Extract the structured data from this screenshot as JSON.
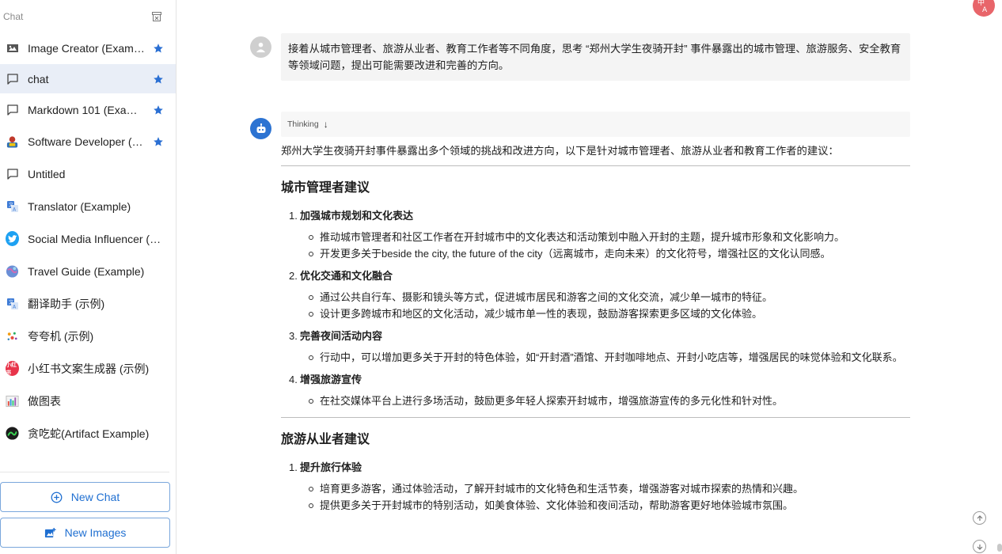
{
  "sidebar": {
    "title": "Chat",
    "items": [
      {
        "label": "Image Creator (Example)",
        "icon": "image-icon",
        "starred": true
      },
      {
        "label": "chat",
        "icon": "chat-bubble-icon",
        "starred": true,
        "active": true
      },
      {
        "label": "Markdown 101 (Example)",
        "icon": "chat-bubble-icon",
        "starred": true
      },
      {
        "label": "Software Developer (Example)",
        "icon": "developer-avatar-icon",
        "starred": true
      },
      {
        "label": "Untitled",
        "icon": "chat-bubble-icon",
        "starred": false
      },
      {
        "label": "Translator (Example)",
        "icon": "translate-icon",
        "starred": false
      },
      {
        "label": "Social Media Influencer (Example)",
        "icon": "twitter-bird-icon",
        "starred": false
      },
      {
        "label": "Travel Guide (Example)",
        "icon": "globe-icon",
        "starred": false
      },
      {
        "label": "翻译助手 (示例)",
        "icon": "translate-icon",
        "starred": false
      },
      {
        "label": "夸夸机 (示例)",
        "icon": "confetti-icon",
        "starred": false
      },
      {
        "label": "小红书文案生成器 (示例)",
        "icon": "xiaohongshu-logo-icon",
        "starred": false
      },
      {
        "label": "做图表",
        "icon": "chart-icon",
        "starred": false
      },
      {
        "label": "贪吃蛇(Artifact Example)",
        "icon": "snake-game-icon",
        "starred": false
      }
    ],
    "xhs_badge": "小红书",
    "new_chat_label": "New Chat",
    "new_images_label": "New Images"
  },
  "chat": {
    "user_message": "接着从城市管理者、旅游从业者、教育工作者等不同角度，思考 “郑州大学生夜骑开封” 事件暴露出的城市管理、旅游服务、安全教育等领域问题，提出可能需要改进和完善的方向。",
    "thinking_label": "Thinking",
    "intro": "郑州大学生夜骑开封事件暴露出多个领域的挑战和改进方向，以下是针对城市管理者、旅游从业者和教育工作者的建议：",
    "sections": [
      {
        "heading": "城市管理者建议",
        "items": [
          {
            "num": "1.",
            "title": "加强城市规划和文化表达",
            "bullets": [
              "推动城市管理者和社区工作者在开封城市中的文化表达和活动策划中融入开封的主题，提升城市形象和文化影响力。",
              "开发更多关于beside the city, the future of the city（远离城市，走向未来）的文化符号，增强社区的文化认同感。"
            ]
          },
          {
            "num": "2.",
            "title": "优化交通和文化融合",
            "bullets": [
              "通过公共自行车、摄影和镜头等方式，促进城市居民和游客之间的文化交流，减少单一城市的特征。",
              "设计更多跨城市和地区的文化活动，减少城市单一性的表现，鼓励游客探索更多区域的文化体验。"
            ]
          },
          {
            "num": "3.",
            "title": "完善夜间活动内容",
            "bullets": [
              "行动中，可以增加更多关于开封的特色体验，如“开封酒”酒馆、开封咖啡地点、开封小吃店等，增强居民的味觉体验和文化联系。"
            ]
          },
          {
            "num": "4.",
            "title": "增强旅游宣传",
            "bullets": [
              "在社交媒体平台上进行多场活动，鼓励更多年轻人探索开封城市，增强旅游宣传的多元化性和针对性。"
            ]
          }
        ]
      },
      {
        "heading": "旅游从业者建议",
        "items": [
          {
            "num": "1.",
            "title": "提升旅行体验",
            "bullets": [
              "培育更多游客，通过体验活动，了解开封城市的文化特色和生活节奏，增强游客对城市探索的热情和兴趣。",
              "提供更多关于开封城市的特别活动，如美食体验、文化体验和夜间活动，帮助游客更好地体验城市氛围。"
            ]
          }
        ]
      }
    ]
  },
  "colors": {
    "accent": "#1f6fd1",
    "star": "#2a6fd3",
    "active_bg": "#e9eef7",
    "bot_avatar": "#2c73d2",
    "user_bubble": "#f4f4f4"
  }
}
